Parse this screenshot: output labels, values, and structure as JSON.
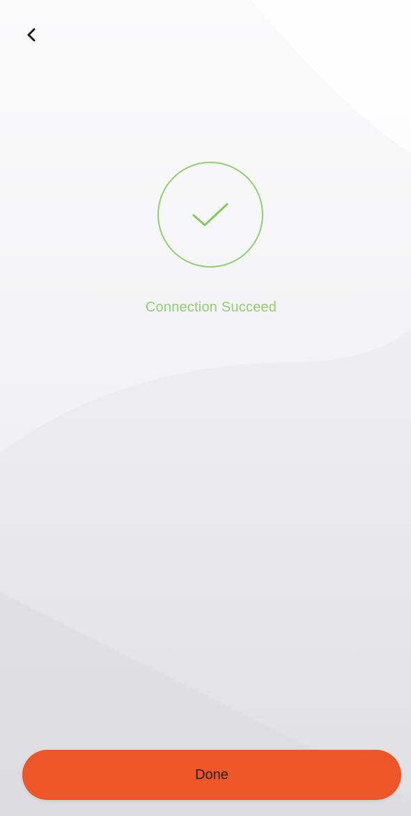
{
  "screen": {
    "status": {
      "text": "Connection Succeed",
      "color": "#8fcf6f"
    },
    "actions": {
      "done_label": "Done",
      "done_color": "#ec5628"
    },
    "icons": {
      "back": "chevron-left-icon",
      "success": "checkmark-icon"
    }
  }
}
